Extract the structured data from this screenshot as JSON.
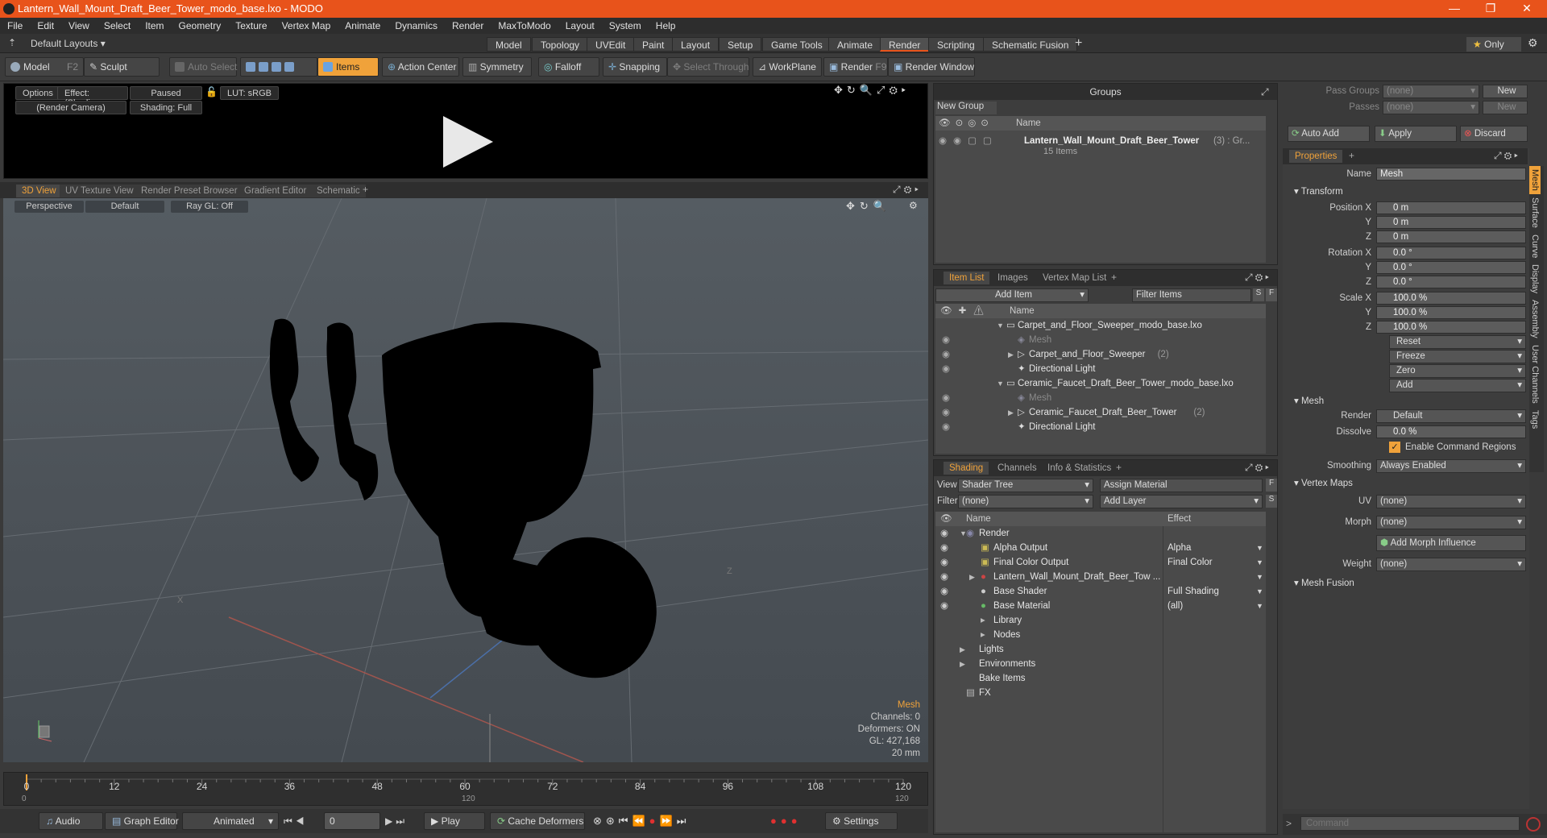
{
  "window": {
    "title": "Lantern_Wall_Mount_Draft_Beer_Tower_modo_base.lxo - MODO"
  },
  "menu": [
    "File",
    "Edit",
    "View",
    "Select",
    "Item",
    "Geometry",
    "Texture",
    "Vertex Map",
    "Animate",
    "Dynamics",
    "Render",
    "MaxToModo",
    "Layout",
    "System",
    "Help"
  ],
  "layouts": {
    "dropdown": "Default Layouts",
    "tabs": [
      "Model",
      "Topology",
      "UVEdit",
      "Paint",
      "Layout",
      "Setup",
      "Game Tools",
      "Animate",
      "Render",
      "Scripting",
      "Schematic Fusion"
    ],
    "active": "Render",
    "only": "Only"
  },
  "toolbar": {
    "model": "Model",
    "model_key": "F2",
    "sculpt": "Sculpt",
    "auto_select": "Auto Select",
    "items": "Items",
    "action_center": "Action Center",
    "symmetry": "Symmetry",
    "falloff": "Falloff",
    "snapping": "Snapping",
    "select_through": "Select Through",
    "workplane": "WorkPlane",
    "render": "Render",
    "render_key": "F9",
    "render_window": "Render Window"
  },
  "render_panel": {
    "options": "Options",
    "effect": "Effect: (Shadi...",
    "paused": "Paused",
    "lut": "LUT: sRGB",
    "camera": "(Render Camera)",
    "shading": "Shading: Full"
  },
  "viewport_tabs": [
    "3D View",
    "UV Texture View",
    "Render Preset Browser",
    "Gradient Editor",
    "Schematic"
  ],
  "viewport": {
    "perspective": "Perspective",
    "default": "Default",
    "raygl": "Ray GL: Off",
    "axis_x": "X",
    "axis_z": "Z"
  },
  "viewport_info": {
    "type": "Mesh",
    "channels": "Channels: 0",
    "deformers": "Deformers: ON",
    "gl": "GL: 427,168",
    "scale": "20 mm"
  },
  "timeline": {
    "ticks": [
      "0",
      "12",
      "24",
      "36",
      "48",
      "60",
      "72",
      "84",
      "96",
      "108",
      "120"
    ],
    "start": "0",
    "mid": "120",
    "end": "120"
  },
  "bottombar": {
    "audio": "Audio",
    "graph_editor": "Graph Editor",
    "animated": "Animated",
    "frame": "0",
    "play": "Play",
    "cache": "Cache Deformers",
    "settings": "Settings"
  },
  "groups": {
    "title": "Groups",
    "new_group": "New Group",
    "col_name": "Name",
    "item": "Lantern_Wall_Mount_Draft_Beer_Tower",
    "item_suffix": "(3) : Gr...",
    "count": "15 Items"
  },
  "item_list": {
    "tabs": [
      "Item List",
      "Images",
      "Vertex Map List"
    ],
    "add_item": "Add Item",
    "filter": "Filter Items",
    "col_name": "Name",
    "rows": [
      {
        "label": "Carpet_and_Floor_Sweeper_modo_base.lxo",
        "indent": 0,
        "arrow": "▼",
        "dim": false
      },
      {
        "label": "Mesh",
        "indent": 1,
        "arrow": "",
        "dim": true
      },
      {
        "label": "Carpet_and_Floor_Sweeper",
        "suffix": "(2)",
        "indent": 1,
        "arrow": "▶",
        "dim": false
      },
      {
        "label": "Directional Light",
        "indent": 1,
        "arrow": "",
        "dim": false
      },
      {
        "label": "Ceramic_Faucet_Draft_Beer_Tower_modo_base.lxo",
        "indent": 0,
        "arrow": "▼",
        "dim": false
      },
      {
        "label": "Mesh",
        "indent": 1,
        "arrow": "",
        "dim": true
      },
      {
        "label": "Ceramic_Faucet_Draft_Beer_Tower",
        "suffix": "(2)",
        "indent": 1,
        "arrow": "▶",
        "dim": false
      },
      {
        "label": "Directional Light",
        "indent": 1,
        "arrow": "",
        "dim": false
      }
    ]
  },
  "shading": {
    "tabs": [
      "Shading",
      "Channels",
      "Info & Statistics"
    ],
    "view_label": "View",
    "view_value": "Shader Tree",
    "assign": "Assign Material",
    "filter_label": "Filter",
    "filter_value": "(none)",
    "add_layer": "Add Layer",
    "col_name": "Name",
    "col_effect": "Effect",
    "rows": [
      {
        "label": "Render",
        "effect": "",
        "indent": 0,
        "eye": true
      },
      {
        "label": "Alpha Output",
        "effect": "Alpha",
        "indent": 1,
        "eye": true
      },
      {
        "label": "Final Color Output",
        "effect": "Final Color",
        "indent": 1,
        "eye": true
      },
      {
        "label": "Lantern_Wall_Mount_Draft_Beer_Tow ...",
        "effect": "",
        "indent": 1,
        "eye": true
      },
      {
        "label": "Base Shader",
        "effect": "Full Shading",
        "indent": 1,
        "eye": true
      },
      {
        "label": "Base Material",
        "effect": "(all)",
        "indent": 1,
        "eye": true
      },
      {
        "label": "Library",
        "effect": "",
        "indent": 1,
        "eye": false
      },
      {
        "label": "Nodes",
        "effect": "",
        "indent": 1,
        "eye": false
      },
      {
        "label": "Lights",
        "effect": "",
        "indent": 0,
        "eye": false
      },
      {
        "label": "Environments",
        "effect": "",
        "indent": 0,
        "eye": false
      },
      {
        "label": "Bake Items",
        "effect": "",
        "indent": 0,
        "eye": false
      },
      {
        "label": "FX",
        "effect": "",
        "indent": 0,
        "eye": false
      }
    ]
  },
  "passes": {
    "pass_groups": "Pass Groups",
    "passes": "Passes",
    "none": "(none)",
    "new": "New",
    "auto_add": "Auto Add",
    "apply": "Apply",
    "discard": "Discard"
  },
  "properties": {
    "tab": "Properties",
    "name_label": "Name",
    "name_value": "Mesh",
    "transform": "Transform",
    "position_label": "Position X",
    "rotation_label": "Rotation X",
    "scale_label": "Scale X",
    "y": "Y",
    "z": "Z",
    "pos": [
      "0 m",
      "0 m",
      "0 m"
    ],
    "rot": [
      "0.0 °",
      "0.0 °",
      "0.0 °"
    ],
    "scl": [
      "100.0 %",
      "100.0 %",
      "100.0 %"
    ],
    "reset": "Reset",
    "freeze": "Freeze",
    "zero": "Zero",
    "add": "Add",
    "mesh": "Mesh",
    "render_label": "Render",
    "render_value": "Default",
    "dissolve_label": "Dissolve",
    "dissolve_value": "0.0 %",
    "enable_cmd": "Enable Command Regions",
    "smoothing_label": "Smoothing",
    "smoothing_value": "Always Enabled",
    "vertex_maps": "Vertex Maps",
    "uv_label": "UV",
    "uv_value": "(none)",
    "morph_label": "Morph",
    "morph_value": "(none)",
    "add_morph": "Add Morph Influence",
    "weight_label": "Weight",
    "weight_value": "(none)",
    "mesh_fusion": "Mesh Fusion"
  },
  "side_tabs": [
    "Mesh",
    "Surface",
    "Curve",
    "Display",
    "Assembly",
    "User Channels",
    "Tags"
  ],
  "command": {
    "placeholder": "Command"
  }
}
